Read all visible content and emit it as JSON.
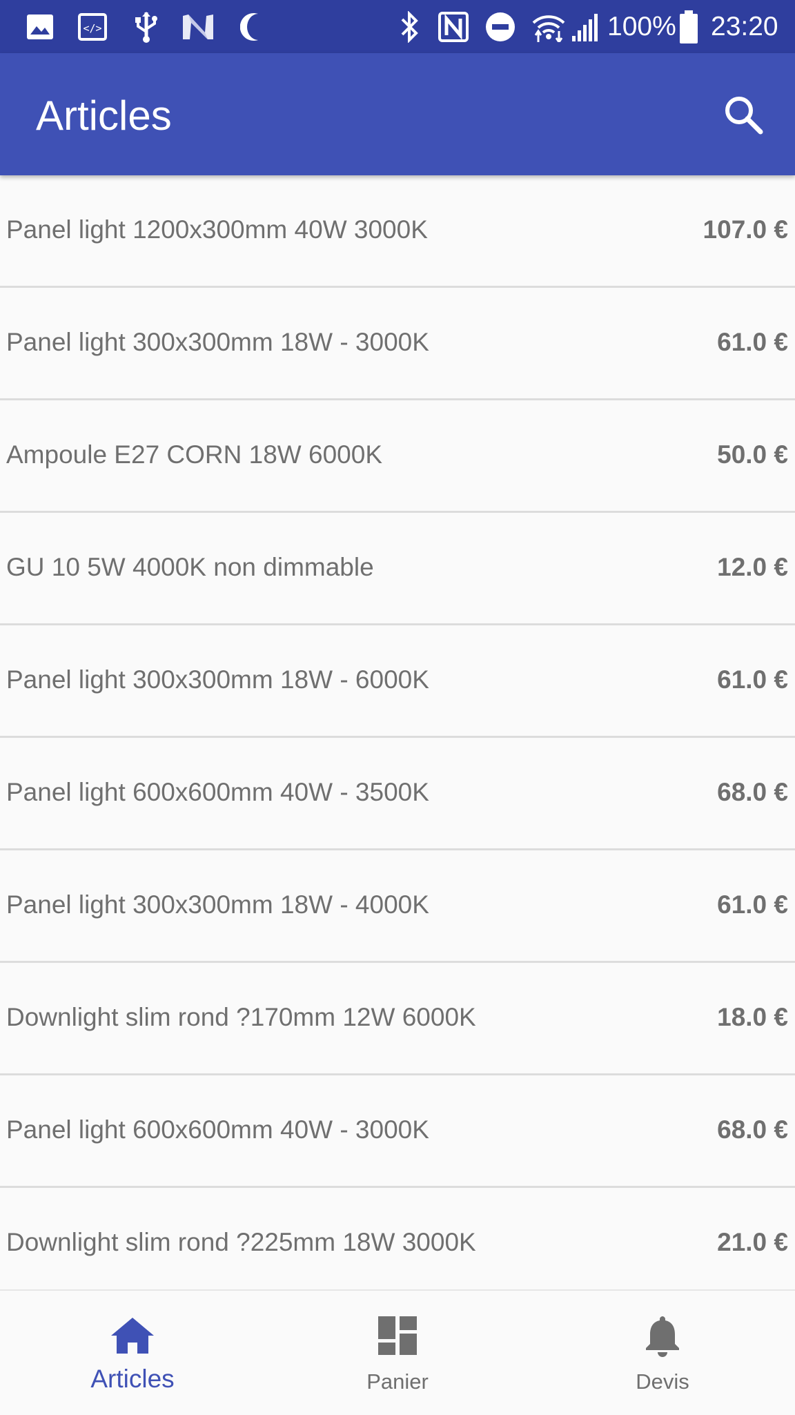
{
  "status_bar": {
    "battery": "100%",
    "time": "23:20",
    "left_icons": [
      "image-icon",
      "code-icon",
      "usb-icon",
      "n-logo-icon",
      "moon-icon"
    ],
    "right_icons": [
      "bluetooth-icon",
      "nfc-icon",
      "do-not-disturb-icon",
      "wifi-icon",
      "signal-icon",
      "battery-icon"
    ]
  },
  "app_bar": {
    "title": "Articles",
    "action_icon": "search-icon",
    "color": "#3f51b5",
    "status_color": "#2f3e9e"
  },
  "articles": [
    {
      "name": "Panel light 1200x300mm 40W 3000K",
      "price": "107.0 €"
    },
    {
      "name": "Panel light 300x300mm 18W - 3000K",
      "price": "61.0 €"
    },
    {
      "name": "Ampoule E27 CORN 18W 6000K",
      "price": "50.0 €"
    },
    {
      "name": "GU 10 5W 4000K non dimmable",
      "price": "12.0 €"
    },
    {
      "name": "Panel light 300x300mm 18W - 6000K",
      "price": "61.0 €"
    },
    {
      "name": "Panel light 600x600mm 40W - 3500K",
      "price": "68.0 €"
    },
    {
      "name": "Panel light 300x300mm 18W - 4000K",
      "price": "61.0 €"
    },
    {
      "name": "Downlight slim rond ?170mm 12W 6000K",
      "price": "18.0 €"
    },
    {
      "name": "Panel light 600x600mm 40W - 3000K",
      "price": "68.0 €"
    },
    {
      "name": "Downlight slim rond ?225mm 18W 3000K",
      "price": "21.0 €"
    }
  ],
  "bottom_nav": {
    "items": [
      {
        "label": "Articles",
        "icon": "home-icon",
        "active": true
      },
      {
        "label": "Panier",
        "icon": "dashboard-icon",
        "active": false
      },
      {
        "label": "Devis",
        "icon": "bell-icon",
        "active": false
      }
    ],
    "active_color": "#3f51b5",
    "inactive_color": "#6f6f6f"
  }
}
